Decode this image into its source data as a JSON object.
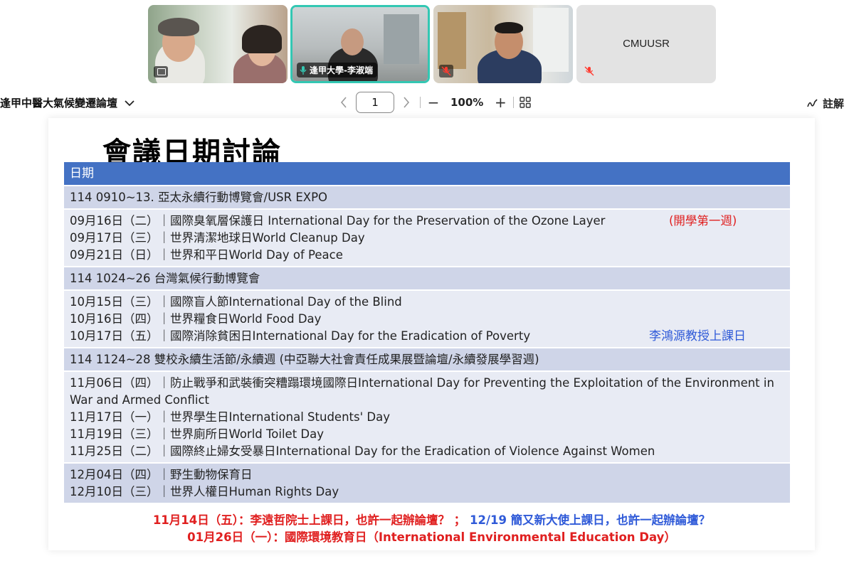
{
  "participants": [
    {
      "name": "",
      "state": "sharing"
    },
    {
      "name": "逢甲大學-李淑端",
      "state": "speaking"
    },
    {
      "name": "",
      "state": "muted"
    },
    {
      "name": "CMUUSR",
      "state": "muted"
    }
  ],
  "toolbar": {
    "doc_title": "逢甲中醫大氣候變遷論壇",
    "page": "1",
    "zoom": "100%",
    "annotate_label": "註解"
  },
  "slide": {
    "title": "會議日期討論",
    "header": "日期",
    "rows": [
      {
        "shade": "dark",
        "lines": [
          "114  0910~13.      亞太永續行動博覽會/USR EXPO"
        ]
      },
      {
        "shade": "light",
        "lines": [
          "09月16日（二）｜國際臭氧層保護日 International Day for the Preservation of the Ozone Layer",
          "09月17日（三）｜世界清潔地球日World Cleanup Day",
          "09月21日（日）｜世界和平日World Day of Peace"
        ],
        "note": "(開學第一週)"
      },
      {
        "shade": "dark",
        "lines": [
          "114  1024~26          台灣氣候行動博覽會"
        ]
      },
      {
        "shade": "light",
        "lines": [
          "10月15日（三）｜國際盲人節International Day of the Blind",
          "10月16日（四）｜世界糧食日World Food Day",
          "10月17日（五）｜國際消除貧困日International Day for the Eradication of Poverty"
        ],
        "note": "李鴻源教授上課日"
      },
      {
        "shade": "dark",
        "lines": [
          "114  1124~28          雙校永續生活節/永續週    (中亞聯大社會責任成果展暨論壇/永續發展學習週)"
        ]
      },
      {
        "shade": "light",
        "lines": [
          "11月06日（四）｜防止戰爭和武裝衝突糟蹋環境國際日International Day for Preventing the Exploitation of the Environment in War and Armed Conflict",
          "11月17日（一）｜世界學生日International Students' Day",
          "11月19日（三）｜世界廁所日World Toilet Day",
          "11月25日（二）｜國際終止婦女受暴日International Day for the Eradication of Violence Against Women"
        ]
      },
      {
        "shade": "dark",
        "lines": [
          "12月04日（四）｜野生動物保育日",
          "12月10日（三）｜世界人權日Human Rights Day"
        ]
      }
    ],
    "footer": {
      "part1": "11月14日（五）：李遠哲院士上課日，也許一起辦論壇？  ；  ",
      "part2": "12/19 簡又新大使上課日，也許一起辦論壇？",
      "line2": "01月26日（一）：國際環境教育日（International Environmental Education Day）"
    }
  },
  "colors": {
    "table_header": "#4472c4",
    "row_dark": "#cfd5e8",
    "row_light": "#e8ebf4",
    "red_note": "#e02020",
    "blue_note": "#2f5ad8",
    "speaker_border": "#33c7b3"
  }
}
